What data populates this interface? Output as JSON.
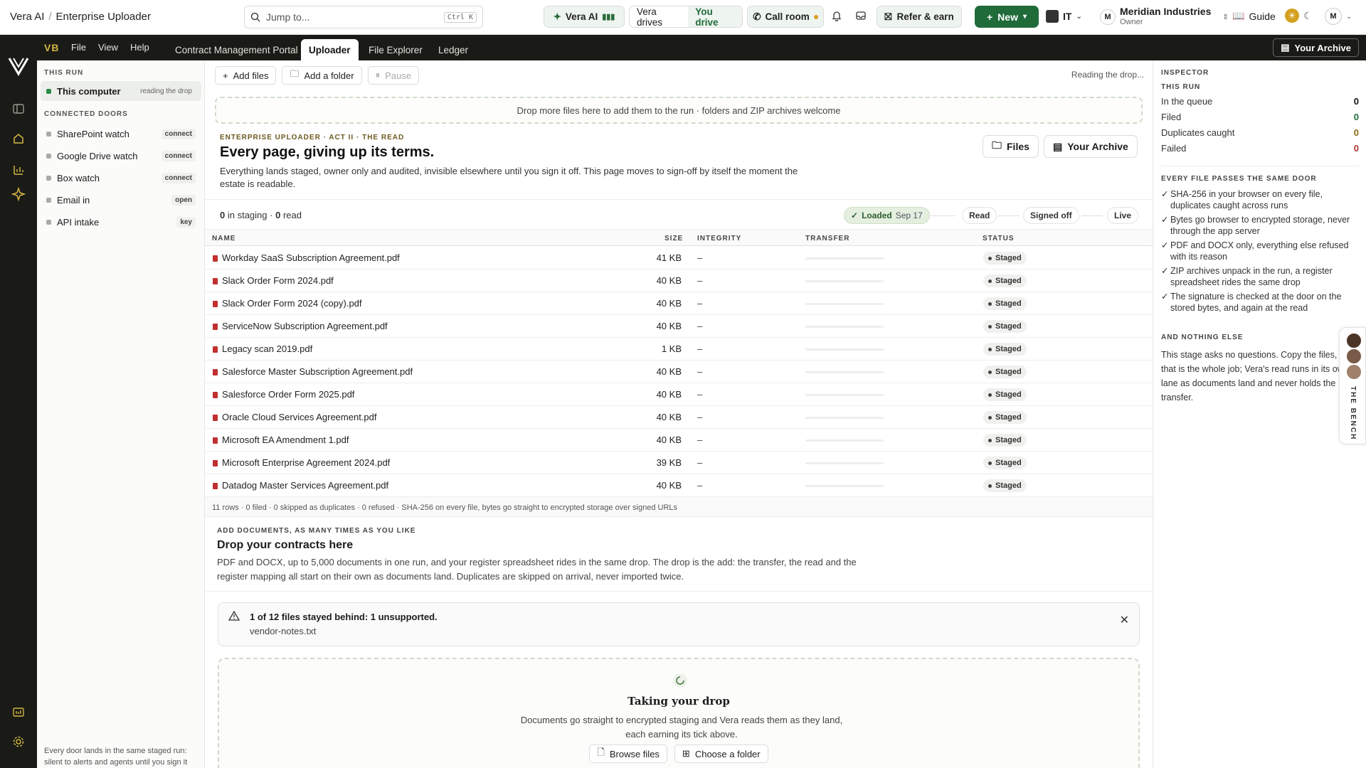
{
  "topbar": {
    "app": "Vera AI",
    "section": "Enterprise Uploader",
    "search_placeholder": "Jump to...",
    "search_shortcut": "Ctrl K",
    "vera_ai": "Vera AI",
    "vera_drives": "Vera drives",
    "you_drive": "You drive",
    "call_room": "Call room",
    "refer": "Refer & earn",
    "new": "New",
    "workspace": "IT",
    "org_initial": "M",
    "org_name": "Meridian Industries",
    "org_role": "Owner",
    "guide": "Guide",
    "user_initial": "M"
  },
  "menubar": {
    "logo": "VB",
    "menus": [
      "File",
      "View",
      "Help"
    ],
    "tabs": [
      "Contract Management Portal",
      "Uploader",
      "File Explorer",
      "Ledger"
    ],
    "active_tab": "Uploader",
    "archive": "Your Archive"
  },
  "sidebar": {
    "this_run_heading": "THIS RUN",
    "this_computer": "This computer",
    "this_computer_status": "reading the drop",
    "doors_heading": "CONNECTED DOORS",
    "doors": [
      {
        "label": "SharePoint watch",
        "tag": "connect"
      },
      {
        "label": "Google Drive watch",
        "tag": "connect"
      },
      {
        "label": "Box watch",
        "tag": "connect"
      },
      {
        "label": "Email in",
        "tag": "open"
      },
      {
        "label": "API intake",
        "tag": "key"
      }
    ],
    "footer": "Every door lands in the same staged run: silent to alerts and agents until you sign it"
  },
  "main": {
    "add_files": "Add files",
    "add_folder": "Add a folder",
    "pause": "Pause",
    "reading": "Reading the drop...",
    "dropzone": "Drop more files here to add them to the run · folders and ZIP archives welcome",
    "eyebrow": "ENTERPRISE UPLOADER · ACT II · THE READ",
    "title": "Every page, giving up its terms.",
    "lead": "Everything lands staged, owner only and audited, invisible elsewhere until you sign it off. This page moves to sign-off by itself the moment the estate is readable.",
    "files_btn": "Files",
    "archive_btn": "Your Archive",
    "staging_count": "0",
    "staging_label": "in staging",
    "read_count": "0",
    "read_label": "read",
    "stages": {
      "loaded": "Loaded",
      "loaded_date": "Sep 17",
      "read": "Read",
      "signed_off": "Signed off",
      "live": "Live"
    },
    "columns": {
      "name": "NAME",
      "size": "SIZE",
      "integrity": "INTEGRITY",
      "transfer": "TRANSFER",
      "status": "STATUS"
    },
    "rows": [
      {
        "name": "Workday SaaS Subscription Agreement.pdf",
        "size": "41 KB",
        "integrity": "–",
        "status": "Staged"
      },
      {
        "name": "Slack Order Form 2024.pdf",
        "size": "40 KB",
        "integrity": "–",
        "status": "Staged"
      },
      {
        "name": "Slack Order Form 2024 (copy).pdf",
        "size": "40 KB",
        "integrity": "–",
        "status": "Staged"
      },
      {
        "name": "ServiceNow Subscription Agreement.pdf",
        "size": "40 KB",
        "integrity": "–",
        "status": "Staged"
      },
      {
        "name": "Legacy scan 2019.pdf",
        "size": "1 KB",
        "integrity": "–",
        "status": "Staged"
      },
      {
        "name": "Salesforce Master Subscription Agreement.pdf",
        "size": "40 KB",
        "integrity": "–",
        "status": "Staged"
      },
      {
        "name": "Salesforce Order Form 2025.pdf",
        "size": "40 KB",
        "integrity": "–",
        "status": "Staged"
      },
      {
        "name": "Oracle Cloud Services Agreement.pdf",
        "size": "40 KB",
        "integrity": "–",
        "status": "Staged"
      },
      {
        "name": "Microsoft EA Amendment 1.pdf",
        "size": "40 KB",
        "integrity": "–",
        "status": "Staged"
      },
      {
        "name": "Microsoft Enterprise Agreement 2024.pdf",
        "size": "39 KB",
        "integrity": "–",
        "status": "Staged"
      },
      {
        "name": "Datadog Master Services Agreement.pdf",
        "size": "40 KB",
        "integrity": "–",
        "status": "Staged"
      }
    ],
    "table_footer": "11 rows · 0 filed · 0 skipped as duplicates · 0 refused · SHA-256 on every file, bytes go straight to encrypted storage over signed URLs",
    "add_eyebrow": "ADD DOCUMENTS, AS MANY TIMES AS YOU LIKE",
    "add_title": "Drop your contracts here",
    "add_text": "PDF and DOCX, up to 5,000 documents in one run, and your register spreadsheet rides in the same drop. The drop is the add: the transfer, the read and the register mapping all start on their own as documents land. Duplicates are skipped on arrival, never imported twice.",
    "alert_title": "1 of 12 files stayed behind: 1 unsupported.",
    "alert_file": "vendor-notes.txt",
    "drop_title": "Taking your drop",
    "drop_text": "Documents go straight to encrypted staging and Vera reads them as they land, each earning its tick above.",
    "browse": "Browse files",
    "choose_folder": "Choose a folder"
  },
  "inspector": {
    "heading": "INSPECTOR",
    "run_heading": "THIS RUN",
    "stats": [
      {
        "label": "In the queue",
        "value": "0"
      },
      {
        "label": "Filed",
        "value": "0"
      },
      {
        "label": "Duplicates caught",
        "value": "0"
      },
      {
        "label": "Failed",
        "value": "0"
      }
    ],
    "door_heading": "EVERY FILE PASSES THE SAME DOOR",
    "checks": [
      "SHA-256 in your browser on every file, duplicates caught across runs",
      "Bytes go browser to encrypted storage, never through the app server",
      "PDF and DOCX only, everything else refused with its reason",
      "ZIP archives unpack in the run, a register spreadsheet rides the same drop",
      "The signature is checked at the door on the stored bytes, and again at the read"
    ],
    "nothing_heading": "AND NOTHING ELSE",
    "nothing_text": "This stage asks no questions. Copy the files, that is the whole job; Vera's read runs in its own lane as documents land and never holds the transfer.",
    "bench": "THE BENCH"
  },
  "colors": {
    "brand_green": "#1f6b3a",
    "dark": "#1a1a17",
    "gold": "#d4b740",
    "pdf_red": "#c03030"
  }
}
